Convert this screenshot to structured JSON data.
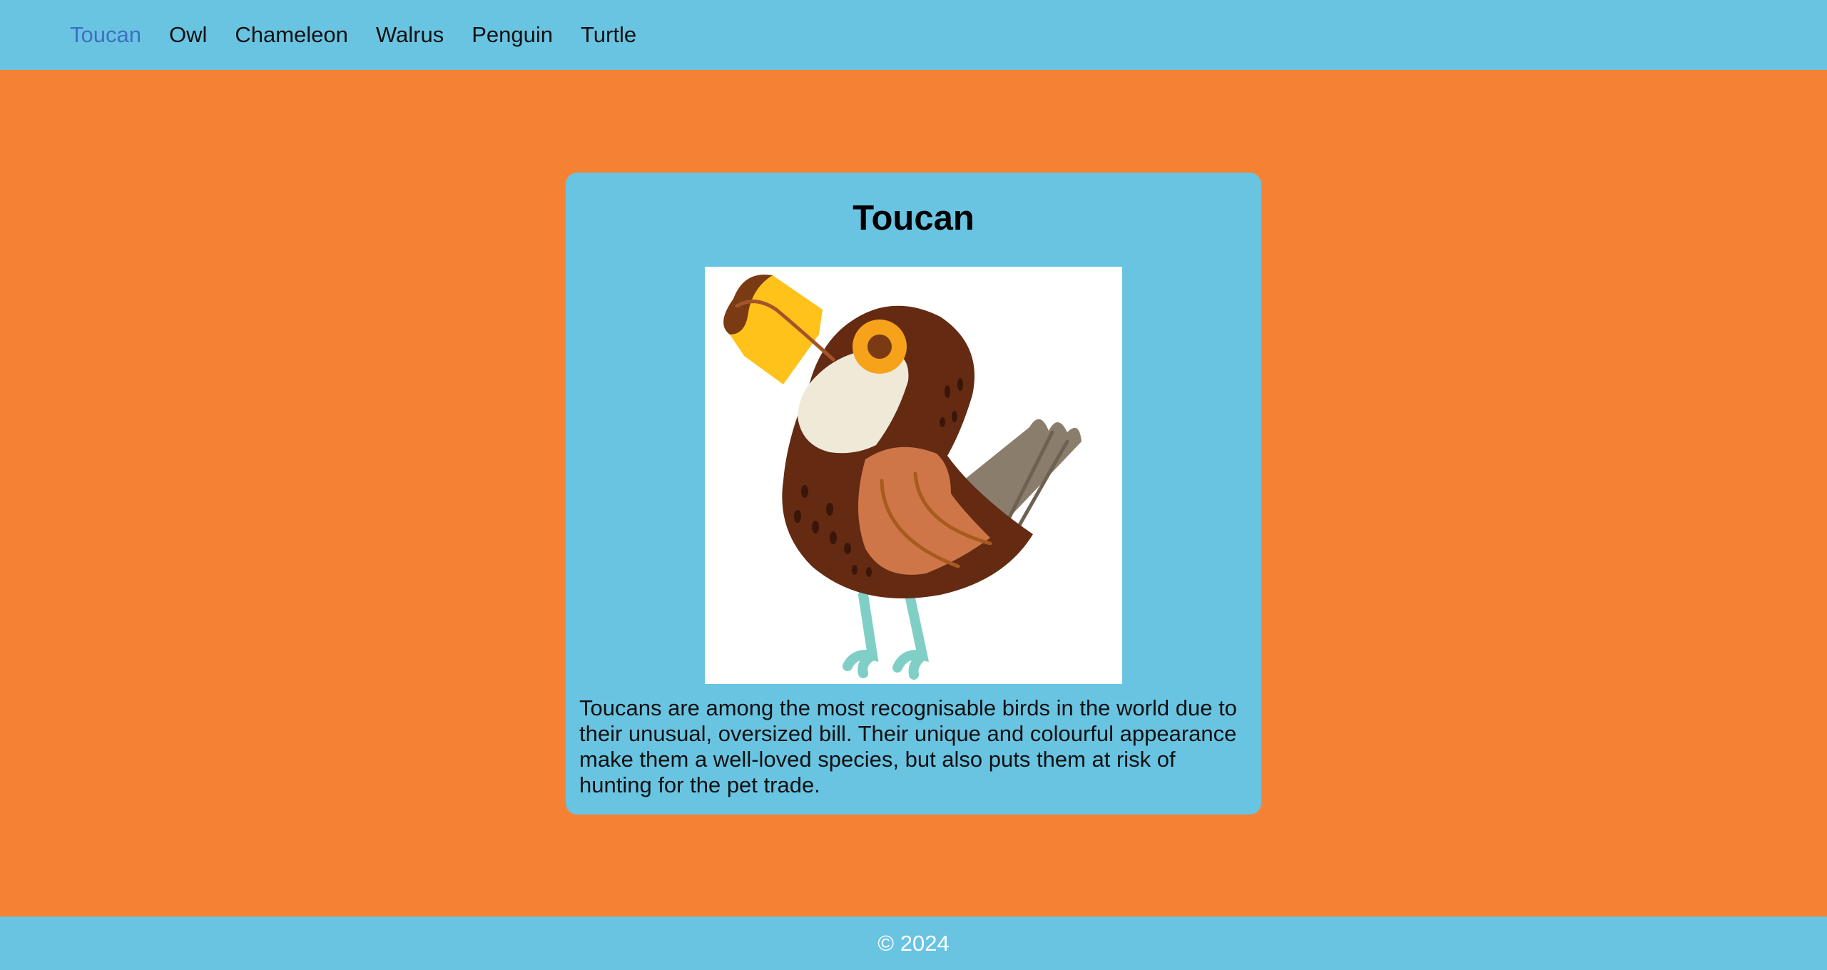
{
  "nav": {
    "items": [
      {
        "label": "Toucan",
        "active": true
      },
      {
        "label": "Owl",
        "active": false
      },
      {
        "label": "Chameleon",
        "active": false
      },
      {
        "label": "Walrus",
        "active": false
      },
      {
        "label": "Penguin",
        "active": false
      },
      {
        "label": "Turtle",
        "active": false
      }
    ]
  },
  "card": {
    "title": "Toucan",
    "image_subject": "toucan-illustration",
    "description": "Toucans are among the most recognisable birds in the world due to their unusual, oversized bill. Their unique and colourful appearance make them a well-loved species, but also puts them at risk of hunting for the pet trade."
  },
  "footer": {
    "copyright": "© 2024"
  },
  "colors": {
    "page_background": "#f58233",
    "panel_background": "#69c4e2",
    "active_link": "#3f6fc0",
    "footer_text": "#ffffff"
  }
}
